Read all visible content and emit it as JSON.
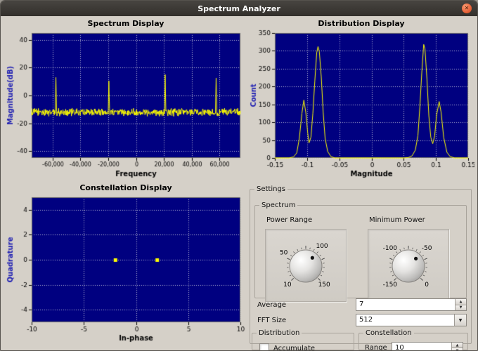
{
  "window": {
    "title": "Spectrum Analyzer"
  },
  "icons": {
    "close": "✕",
    "spin_up": "▲",
    "spin_down": "▼",
    "dropdown_arrow": "▼"
  },
  "colors": {
    "plot_bg": "#000080",
    "trace": "#ffff00",
    "grid_dots": "#e8e8e8",
    "y_axis_label": "#2020b2",
    "x_axis_label": "#000000",
    "titlebar": "#3b3733",
    "close_button": "#e8633a"
  },
  "chart_data": [
    {
      "id": "spectrum",
      "type": "line",
      "title": "Spectrum Display",
      "xlabel": "Frequency",
      "ylabel": "Magnitude(dB)",
      "xlim": [
        -75000,
        75000
      ],
      "ylim": [
        -45,
        45
      ],
      "grid": true,
      "xticks": [
        {
          "v": -60000,
          "label": "-60,000"
        },
        {
          "v": -40000,
          "label": "-40,000"
        },
        {
          "v": -20000,
          "label": "-20,000"
        },
        {
          "v": 0,
          "label": "0"
        },
        {
          "v": 20000,
          "label": "20,000"
        },
        {
          "v": 40000,
          "label": "40,000"
        },
        {
          "v": 60000,
          "label": "60,000"
        }
      ],
      "yticks": [
        {
          "v": 40,
          "label": "40"
        },
        {
          "v": 20,
          "label": "20"
        },
        {
          "v": 0,
          "label": "0"
        },
        {
          "v": -20,
          "label": "-20"
        },
        {
          "v": -40,
          "label": "-40"
        }
      ],
      "noise_floor_db": -12,
      "noise_variation_db": 3.2,
      "tones": [
        {
          "freq": -57500,
          "db": 13
        },
        {
          "freq": -19500,
          "db": 10.5
        },
        {
          "freq": 21000,
          "db": 15
        },
        {
          "freq": 57500,
          "db": 12.5
        }
      ]
    },
    {
      "id": "distribution",
      "type": "line",
      "title": "Distribution Display",
      "xlabel": "Magnitude",
      "ylabel": "Count",
      "xlim": [
        -0.15,
        0.15
      ],
      "ylim": [
        0,
        350
      ],
      "grid": true,
      "xticks": [
        {
          "v": -0.15,
          "label": "-0.15"
        },
        {
          "v": -0.1,
          "label": "-0.1"
        },
        {
          "v": -0.05,
          "label": "-0.05"
        },
        {
          "v": 0,
          "label": "0"
        },
        {
          "v": 0.05,
          "label": "0.05"
        },
        {
          "v": 0.1,
          "label": "0.1"
        },
        {
          "v": 0.15,
          "label": "0.15"
        }
      ],
      "yticks": [
        {
          "v": 0,
          "label": "0"
        },
        {
          "v": 50,
          "label": "50"
        },
        {
          "v": 100,
          "label": "100"
        },
        {
          "v": 150,
          "label": "150"
        },
        {
          "v": 200,
          "label": "200"
        },
        {
          "v": 250,
          "label": "250"
        },
        {
          "v": 300,
          "label": "300"
        },
        {
          "v": 350,
          "label": "350"
        }
      ],
      "points": [
        [
          -0.15,
          0
        ],
        [
          -0.128,
          0
        ],
        [
          -0.121,
          3
        ],
        [
          -0.116,
          14
        ],
        [
          -0.112,
          55
        ],
        [
          -0.108,
          125
        ],
        [
          -0.105,
          162
        ],
        [
          -0.102,
          128
        ],
        [
          -0.099,
          70
        ],
        [
          -0.097,
          42
        ],
        [
          -0.094,
          58
        ],
        [
          -0.091,
          125
        ],
        [
          -0.088,
          215
        ],
        [
          -0.085,
          295
        ],
        [
          -0.083,
          312
        ],
        [
          -0.081,
          298
        ],
        [
          -0.078,
          228
        ],
        [
          -0.075,
          128
        ],
        [
          -0.072,
          55
        ],
        [
          -0.068,
          18
        ],
        [
          -0.063,
          4
        ],
        [
          -0.057,
          0
        ],
        [
          -0.05,
          0
        ],
        [
          0.05,
          0
        ],
        [
          0.057,
          1
        ],
        [
          0.063,
          6
        ],
        [
          0.068,
          22
        ],
        [
          0.072,
          62
        ],
        [
          0.075,
          142
        ],
        [
          0.078,
          238
        ],
        [
          0.081,
          318
        ],
        [
          0.083,
          305
        ],
        [
          0.086,
          222
        ],
        [
          0.089,
          118
        ],
        [
          0.092,
          58
        ],
        [
          0.095,
          40
        ],
        [
          0.098,
          62
        ],
        [
          0.101,
          120
        ],
        [
          0.105,
          158
        ],
        [
          0.108,
          128
        ],
        [
          0.112,
          58
        ],
        [
          0.117,
          16
        ],
        [
          0.122,
          4
        ],
        [
          0.129,
          0
        ],
        [
          0.15,
          0
        ]
      ]
    },
    {
      "id": "constellation",
      "type": "scatter",
      "title": "Constellation Display",
      "xlabel": "In-phase",
      "ylabel": "Quadrature",
      "xlim": [
        -10,
        10
      ],
      "ylim": [
        -5,
        5
      ],
      "grid": true,
      "xticks": [
        {
          "v": -10,
          "label": "-10"
        },
        {
          "v": -5,
          "label": "-5"
        },
        {
          "v": 0,
          "label": "0"
        },
        {
          "v": 5,
          "label": "5"
        },
        {
          "v": 10,
          "label": "10"
        }
      ],
      "yticks": [
        {
          "v": 4,
          "label": "4"
        },
        {
          "v": 2,
          "label": "2"
        },
        {
          "v": 0,
          "label": "0"
        },
        {
          "v": -2,
          "label": "-2"
        },
        {
          "v": -4,
          "label": "-4"
        }
      ],
      "points": [
        [
          -2,
          0
        ],
        [
          2,
          0
        ]
      ]
    }
  ],
  "settings": {
    "legend": "Settings",
    "spectrum_group": {
      "legend": "Spectrum",
      "power_range": {
        "label": "Power Range",
        "min": 10,
        "max": 150,
        "value": 100,
        "scale_labels": [
          {
            "value": 10,
            "text": "10"
          },
          {
            "value": 50,
            "text": "50"
          },
          {
            "value": 100,
            "text": "100"
          },
          {
            "value": 150,
            "text": "150"
          }
        ]
      },
      "minimum_power": {
        "label": "Minimum Power",
        "min": -150,
        "max": 0,
        "value": -50,
        "scale_labels": [
          {
            "value": -150,
            "text": "-150"
          },
          {
            "value": -100,
            "text": "-100"
          },
          {
            "value": -50,
            "text": "-50"
          },
          {
            "value": 0,
            "text": "0"
          }
        ]
      }
    },
    "average": {
      "label": "Average",
      "value": "7"
    },
    "fft_size": {
      "label": "FFT Size",
      "value": "512"
    },
    "distribution_group": {
      "legend": "Distribution",
      "accumulate_label": "Accumulate",
      "accumulate_checked": false
    },
    "constellation_group": {
      "legend": "Constellation",
      "range_label": "Range",
      "range_value": "10"
    }
  }
}
